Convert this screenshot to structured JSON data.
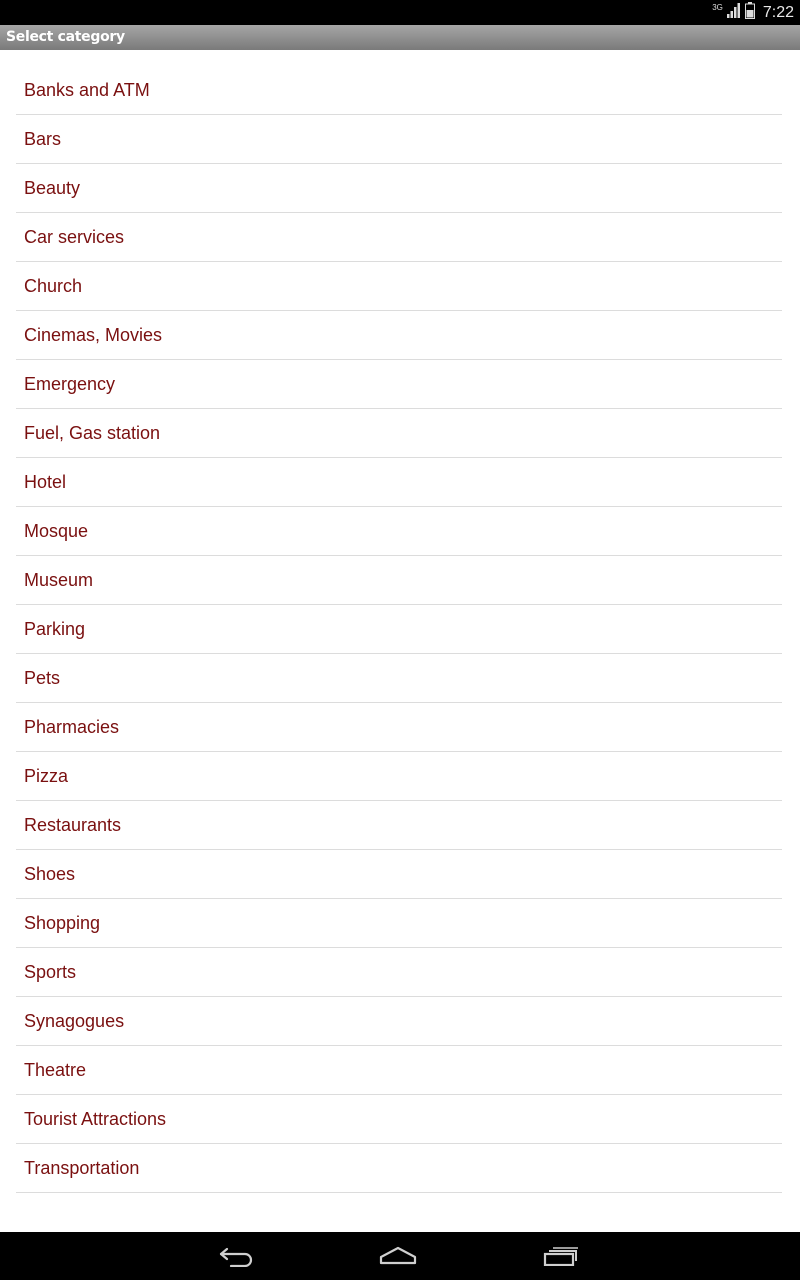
{
  "status_bar": {
    "network": "3G",
    "time": "7:22"
  },
  "title_bar": {
    "title": "Select category"
  },
  "categories": [
    "Banks and ATM",
    "Bars",
    "Beauty",
    "Car services",
    "Church",
    "Cinemas, Movies",
    "Emergency",
    "Fuel, Gas station",
    "Hotel",
    "Mosque",
    "Museum",
    "Parking",
    "Pets",
    "Pharmacies",
    "Pizza",
    "Restaurants",
    "Shoes",
    "Shopping",
    "Sports",
    "Synagogues",
    "Theatre",
    "Tourist Attractions",
    "Transportation"
  ],
  "nav_bar": {
    "buttons": [
      "back-icon",
      "home-icon",
      "recent-apps-icon"
    ]
  },
  "colors": {
    "item_text": "#7a1010",
    "divider": "#dcdcdc",
    "title_bar": "#8e8e8e"
  }
}
